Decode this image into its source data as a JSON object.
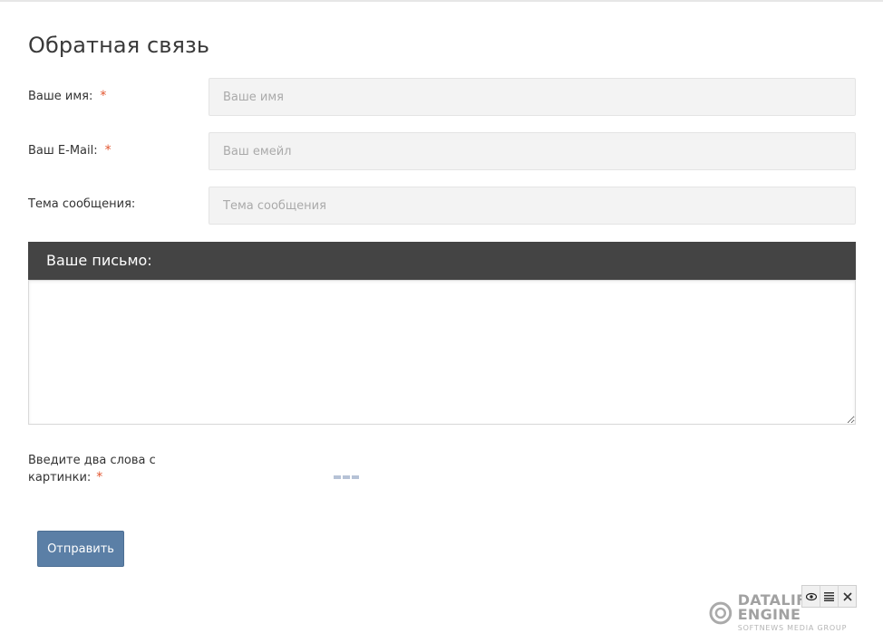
{
  "form": {
    "title": "Обратная связь",
    "fields": [
      {
        "label": "Ваше имя:",
        "required_mark": "*",
        "placeholder": "Ваше имя",
        "value": ""
      },
      {
        "label": "Ваш E-Mail:",
        "required_mark": "*",
        "placeholder": "Ваш емейл",
        "value": ""
      },
      {
        "label": "Тема сообщения:",
        "required_mark": "",
        "placeholder": "Тема сообщения",
        "value": ""
      }
    ],
    "letter_header": "Ваше письмо:",
    "letter_value": "",
    "captcha_label": "Введите два слова с картинки:",
    "captcha_required_mark": "*",
    "submit_label": "Отправить"
  },
  "footer": {
    "logo_title": "DATALIFE ENGINE",
    "logo_subtitle": "SOFTNEWS MEDIA GROUP",
    "tools": [
      "eye-icon",
      "list-icon",
      "close-icon"
    ]
  },
  "colors": {
    "accent_button": "#5b7fa6",
    "header_bar": "#444444",
    "required": "#e2552f",
    "input_bg": "#f3f3f3"
  }
}
